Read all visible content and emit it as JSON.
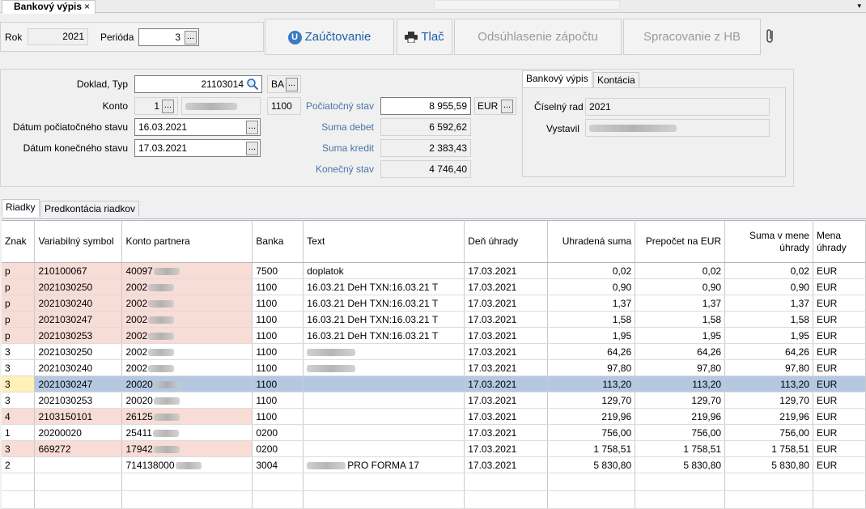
{
  "window": {
    "tab_title": "Bankový výpis",
    "close": "×",
    "dropdown": "▾"
  },
  "toolbar": {
    "rok_label": "Rok",
    "rok_value": "2021",
    "perioda_label": "Perióda",
    "perioda_value": "3",
    "ellipsis": "...",
    "zauctovanie": "Zaúčtovanie",
    "zauctovanie_icon": "U",
    "tlac": "Tlač",
    "odsuhlasenie": "Odsúhlasenie zápočtu",
    "spracovanie": "Spracovanie z HB"
  },
  "form": {
    "doklad_label": "Doklad, Typ",
    "doklad_value": "21103014",
    "typ_value": "BA",
    "konto_label": "Konto",
    "konto_value": "1",
    "konto_code": "1100",
    "datum_poc_label": "Dátum počiatočného stavu",
    "datum_poc_value": "16.03.2021",
    "datum_kon_label": "Dátum konečného stavu",
    "datum_kon_value": "17.03.2021",
    "poc_stav_label": "Počiatočný stav",
    "poc_stav_value": "8 955,59",
    "mena": "EUR",
    "suma_debet_label": "Suma debet",
    "suma_debet_value": "6 592,62",
    "suma_kredit_label": "Suma kredit",
    "suma_kredit_value": "2 383,43",
    "kon_stav_label": "Konečný stav",
    "kon_stav_value": "4 746,40"
  },
  "right_panel": {
    "tab_vypis": "Bankový výpis",
    "tab_kontacia": "Kontácia",
    "ciselny_rad_label": "Číselný rad",
    "ciselny_rad_value": "2021",
    "vystavil_label": "Vystavil"
  },
  "grid_tabs": {
    "riadky": "Riadky",
    "predkontacia": "Predkontácia riadkov"
  },
  "grid": {
    "headers": [
      "Znak",
      "Variabilný symbol",
      "Konto partnera",
      "Banka",
      "Text",
      "Deň úhrady",
      "Uhradená suma",
      "Prepočet na EUR",
      "Suma v mene úhrady",
      "Mena úhrady"
    ],
    "rows": [
      {
        "znak": "p",
        "vs": "210100067",
        "konto": "40097",
        "banka": "7500",
        "text": "doplatok",
        "den": "17.03.2021",
        "suma": "0,02",
        "eur": "0,02",
        "mena_suma": "0,02",
        "mena": "EUR"
      },
      {
        "znak": "p",
        "vs": "2021030250",
        "konto": "2002",
        "banka": "1100",
        "text": "16.03.21  DeН TXN:16.03.21  T",
        "den": "17.03.2021",
        "suma": "0,90",
        "eur": "0,90",
        "mena_suma": "0,90",
        "mena": "EUR"
      },
      {
        "znak": "p",
        "vs": "2021030240",
        "konto": "2002",
        "banka": "1100",
        "text": "16.03.21  DeН TXN:16.03.21  T",
        "den": "17.03.2021",
        "suma": "1,37",
        "eur": "1,37",
        "mena_suma": "1,37",
        "mena": "EUR"
      },
      {
        "znak": "p",
        "vs": "2021030247",
        "konto": "2002",
        "banka": "1100",
        "text": "16.03.21  DeН TXN:16.03.21  T",
        "den": "17.03.2021",
        "suma": "1,58",
        "eur": "1,58",
        "mena_suma": "1,58",
        "mena": "EUR"
      },
      {
        "znak": "p",
        "vs": "2021030253",
        "konto": "2002",
        "banka": "1100",
        "text": "16.03.21  DeН TXN:16.03.21  T",
        "den": "17.03.2021",
        "suma": "1,95",
        "eur": "1,95",
        "mena_suma": "1,95",
        "mena": "EUR"
      },
      {
        "znak": "3",
        "vs": "2021030250",
        "konto": "2002",
        "banka": "1100",
        "text": "",
        "den": "17.03.2021",
        "suma": "64,26",
        "eur": "64,26",
        "mena_suma": "64,26",
        "mena": "EUR"
      },
      {
        "znak": "3",
        "vs": "2021030240",
        "konto": "2002",
        "banka": "1100",
        "text": "",
        "den": "17.03.2021",
        "suma": "97,80",
        "eur": "97,80",
        "mena_suma": "97,80",
        "mena": "EUR"
      },
      {
        "znak": "3",
        "vs": "2021030247",
        "konto": "20020",
        "banka": "1100",
        "text": "",
        "den": "17.03.2021",
        "suma": "113,20",
        "eur": "113,20",
        "mena_suma": "113,20",
        "mena": "EUR"
      },
      {
        "znak": "3",
        "vs": "2021030253",
        "konto": "20020",
        "banka": "1100",
        "text": "",
        "den": "17.03.2021",
        "suma": "129,70",
        "eur": "129,70",
        "mena_suma": "129,70",
        "mena": "EUR"
      },
      {
        "znak": "4",
        "vs": "2103150101",
        "konto": "26125",
        "banka": "1100",
        "text": "",
        "den": "17.03.2021",
        "suma": "219,96",
        "eur": "219,96",
        "mena_suma": "219,96",
        "mena": "EUR"
      },
      {
        "znak": "1",
        "vs": "20200020",
        "konto": "25411",
        "banka": "0200",
        "text": "",
        "den": "17.03.2021",
        "suma": "756,00",
        "eur": "756,00",
        "mena_suma": "756,00",
        "mena": "EUR"
      },
      {
        "znak": "3",
        "vs": "669272",
        "konto": "17942",
        "banka": "0200",
        "text": "",
        "den": "17.03.2021",
        "suma": "1 758,51",
        "eur": "1 758,51",
        "mena_suma": "1 758,51",
        "mena": "EUR"
      },
      {
        "znak": "2",
        "vs": "",
        "konto": "714138000",
        "banka": "3004",
        "text": "PRO FORMA 17",
        "den": "17.03.2021",
        "suma": "5 830,80",
        "eur": "5 830,80",
        "mena_suma": "5 830,80",
        "mena": "EUR"
      }
    ]
  }
}
